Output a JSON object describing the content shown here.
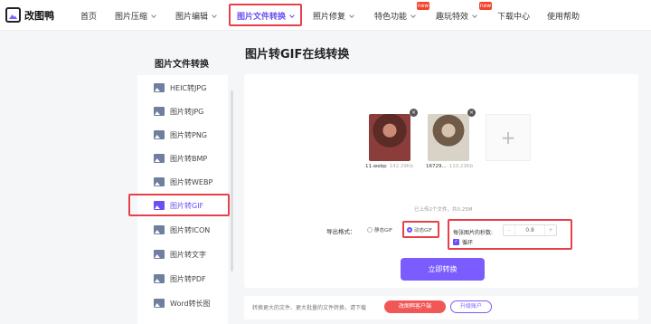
{
  "brand": {
    "name": "改图鸭"
  },
  "nav": {
    "home": "首页",
    "compress": "图片压缩",
    "edit": "图片编辑",
    "convert": "图片文件转换",
    "repair": "照片修复",
    "special": "特色功能",
    "fun": "趣玩特效",
    "download": "下载中心",
    "help": "使用帮助",
    "new_badge": "new"
  },
  "sidebar": {
    "title": "图片文件转换",
    "items": [
      {
        "label": "HEIC转JPG"
      },
      {
        "label": "图片转JPG"
      },
      {
        "label": "图片转PNG"
      },
      {
        "label": "图片转BMP"
      },
      {
        "label": "图片转WEBP"
      },
      {
        "label": "图片转GIF"
      },
      {
        "label": "图片转ICON"
      },
      {
        "label": "图片转文字"
      },
      {
        "label": "图片转PDF"
      },
      {
        "label": "Word转长图"
      }
    ],
    "active_index": 5
  },
  "main": {
    "title": "图片转GIF在线转换",
    "files": [
      {
        "name": "11.webp",
        "size": "142.29Kb"
      },
      {
        "name": "16729...",
        "size": "110.23Kb"
      }
    ],
    "add_icon": "+",
    "uploaded_text": "已上传2个文件，共0.25M",
    "format_label": "导出格式：",
    "format_static": "静态GIF",
    "format_animated": "动态GIF",
    "frames_label": "每张图片的秒数:",
    "frames_value": "0.8",
    "minus": "-",
    "plus": "+",
    "loop_label": "循环",
    "convert_button": "立即转换"
  },
  "footer": {
    "text": "转换更大的文件、更大批量的文件转换，请下载",
    "client_button": "改图鸭客户端",
    "upgrade_button": "升级账户"
  },
  "colors": {
    "accent": "#6b4ef6",
    "highlight": "#e8404a",
    "button": "#7b5cff"
  }
}
